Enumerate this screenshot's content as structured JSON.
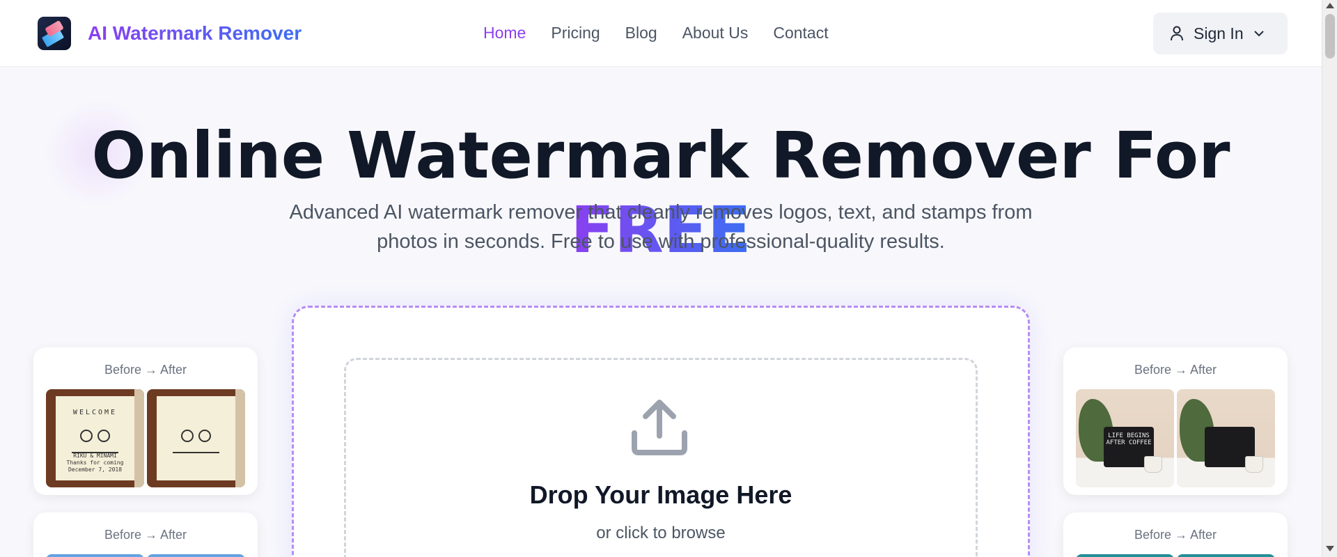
{
  "brand": {
    "name": "AI Watermark Remover"
  },
  "nav": [
    {
      "label": "Home",
      "active": true
    },
    {
      "label": "Pricing"
    },
    {
      "label": "Blog"
    },
    {
      "label": "About Us"
    },
    {
      "label": "Contact"
    }
  ],
  "signin": {
    "label": "Sign In",
    "icon": "user-icon"
  },
  "hero": {
    "title": "Online Watermark Remover For",
    "title_highlight": "FREE",
    "subtitle_line1": "Advanced AI watermark remover that cleanly removes logos, text, and stamps from",
    "subtitle_line2": "photos in seconds. Free to use with professional-quality results."
  },
  "upload": {
    "title": "Drop Your Image Here",
    "subtitle": "or click to browse",
    "icon": "upload-icon"
  },
  "samples": {
    "label": "Before → After",
    "welcome_title": "WELCOME",
    "welcome_caption_1": "RIKU & MINAMI",
    "welcome_caption_2": "Thanks for coming",
    "welcome_caption_3": "December 7, 2018",
    "coffee_board": "LIFE BEGINS AFTER COFFEE"
  },
  "colors": {
    "accent": "#8b3ff0",
    "accent_to": "#3b6ff2"
  }
}
